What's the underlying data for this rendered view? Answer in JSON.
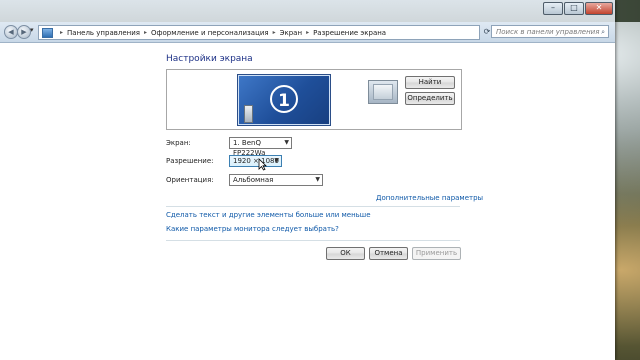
{
  "window": {
    "minimize_glyph": "–",
    "maximize_glyph": "□",
    "close_glyph": "✕"
  },
  "nav": {
    "back_glyph": "◀",
    "forward_glyph": "▶",
    "dropdown_glyph": "▾",
    "breadcrumb_sep": "▸",
    "refresh_glyph": "⟳"
  },
  "breadcrumbs": [
    "Панель управления",
    "Оформление и персонализация",
    "Экран",
    "Разрешение экрана"
  ],
  "search": {
    "placeholder": "Поиск в панели управления",
    "icon": "search-icon",
    "icon_glyph": "⌕"
  },
  "page": {
    "title": "Настройки экрана",
    "monitor_number": "1",
    "find_button": "Найти",
    "identify_button": "Определить"
  },
  "settings": {
    "screen_label": "Экран:",
    "screen_value": "1. BenQ FP222Wa",
    "resolution_label": "Разрешение:",
    "resolution_value": "1920 × 1080",
    "orientation_label": "Ориентация:",
    "orientation_value": "Альбомная",
    "arrow_glyph": "▼"
  },
  "links": {
    "advanced": "Дополнительные параметры",
    "text_size": "Сделать текст и другие элементы больше или меньше",
    "monitor_help": "Какие параметры монитора следует выбрать?"
  },
  "buttons": {
    "ok": "ОК",
    "cancel": "Отмена",
    "apply": "Применить"
  }
}
